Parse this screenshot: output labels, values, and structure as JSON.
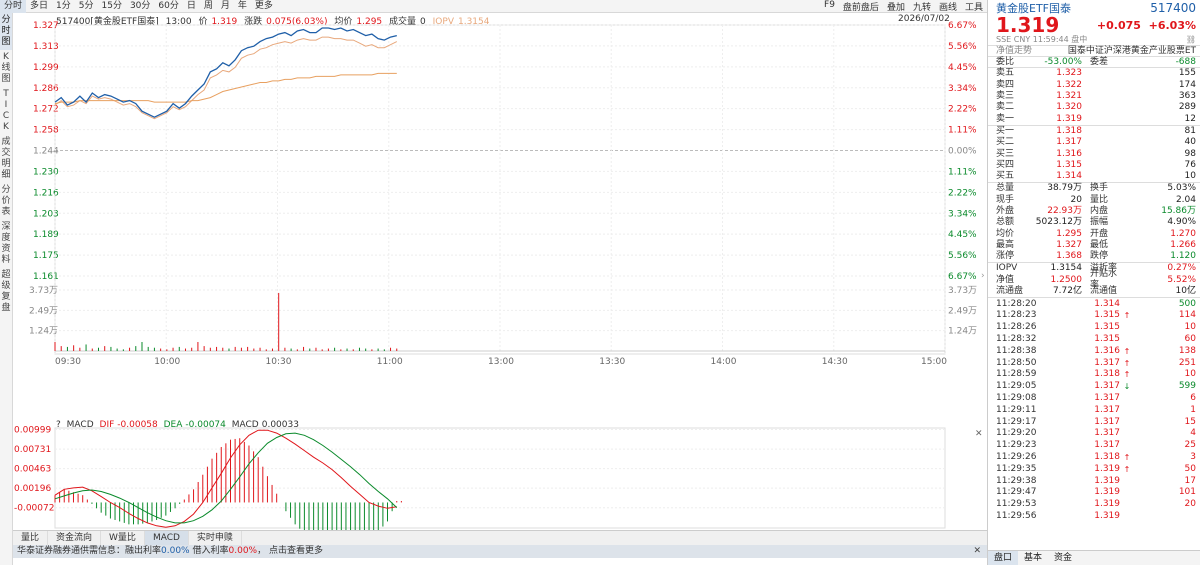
{
  "toolbar": {
    "tabs": [
      "分时",
      "多日",
      "1分",
      "5分",
      "15分",
      "30分",
      "60分",
      "日",
      "周",
      "月",
      "年",
      "更多"
    ],
    "right": [
      "F9",
      "盘前盘后",
      "叠加",
      "九转",
      "画线",
      "工具"
    ]
  },
  "left_tabs": [
    "分时图",
    "K线图",
    "TICK",
    "成交明细",
    "分价表",
    "深度资料",
    "超级复盘"
  ],
  "info": {
    "title": "517400[黄金股ETF国泰]",
    "time": "13:00",
    "price_label": "价",
    "price": "1.319",
    "chg_label": "涨跌",
    "chg": "0.075(6.03%)",
    "avg_label": "均价",
    "avg": "1.295",
    "vol_label": "成交量",
    "vol": "0",
    "iopv_label": "IOPV",
    "iopv": "1.3154",
    "date": "2026/07/02"
  },
  "chart_data": {
    "type": "line",
    "x_range": [
      "09:30",
      "15:00"
    ],
    "x_ticks": [
      "09:30",
      "10:00",
      "10:30",
      "11:00",
      "13:00",
      "13:30",
      "14:00",
      "14:30",
      "15:00"
    ],
    "price_ticks_up": [
      "1.327",
      "1.313",
      "1.299",
      "1.286",
      "1.272",
      "1.258"
    ],
    "price_mid": "1.244",
    "price_ticks_down": [
      "1.230",
      "1.216",
      "1.203",
      "1.189",
      "1.175",
      "1.161"
    ],
    "pct_ticks_up": [
      "6.67%",
      "5.56%",
      "4.45%",
      "3.34%",
      "2.22%",
      "1.11%"
    ],
    "pct_mid": "0.00%",
    "pct_ticks_down": [
      "1.11%",
      "2.22%",
      "3.34%",
      "4.45%",
      "5.56%",
      "6.67%"
    ],
    "vol_ticks": [
      "3.73万",
      "2.49万",
      "1.24万"
    ],
    "ylim": [
      1.161,
      1.327
    ],
    "price_series": [
      1.276,
      1.279,
      1.274,
      1.276,
      1.28,
      1.276,
      1.282,
      1.279,
      1.281,
      1.28,
      1.278,
      1.276,
      1.277,
      1.275,
      1.27,
      1.268,
      1.266,
      1.268,
      1.27,
      1.275,
      1.272,
      1.275,
      1.28,
      1.284,
      1.288,
      1.296,
      1.298,
      1.302,
      1.3,
      1.304,
      1.31,
      1.312,
      1.313,
      1.316,
      1.318,
      1.319,
      1.321,
      1.322,
      1.32,
      1.323,
      1.324,
      1.322,
      1.322,
      1.325,
      1.325,
      1.324,
      1.325,
      1.323,
      1.324,
      1.322,
      1.32,
      1.321,
      1.318,
      1.317,
      1.319,
      1.32
    ],
    "iopv_series": [
      1.274,
      1.277,
      1.273,
      1.274,
      1.277,
      1.275,
      1.28,
      1.278,
      1.279,
      1.278,
      1.276,
      1.274,
      1.275,
      1.273,
      1.269,
      1.267,
      1.265,
      1.267,
      1.269,
      1.273,
      1.271,
      1.273,
      1.277,
      1.281,
      1.284,
      1.292,
      1.294,
      1.297,
      1.296,
      1.299,
      1.305,
      1.307,
      1.308,
      1.311,
      1.312,
      1.314,
      1.315,
      1.316,
      1.315,
      1.317,
      1.318,
      1.317,
      1.317,
      1.319,
      1.319,
      1.318,
      1.318,
      1.317,
      1.317,
      1.315,
      1.313,
      1.314,
      1.312,
      1.312,
      1.314,
      1.316
    ],
    "avg_series": [
      1.275,
      1.276,
      1.276,
      1.276,
      1.277,
      1.277,
      1.277,
      1.277,
      1.277,
      1.277,
      1.277,
      1.277,
      1.277,
      1.277,
      1.277,
      1.277,
      1.276,
      1.276,
      1.276,
      1.276,
      1.276,
      1.276,
      1.277,
      1.277,
      1.278,
      1.279,
      1.281,
      1.283,
      1.284,
      1.285,
      1.286,
      1.287,
      1.288,
      1.289,
      1.289,
      1.29,
      1.29,
      1.291,
      1.291,
      1.292,
      1.292,
      1.292,
      1.293,
      1.293,
      1.293,
      1.293,
      1.294,
      1.294,
      1.294,
      1.294,
      1.294,
      1.294,
      1.295,
      1.295,
      1.295,
      1.295
    ],
    "volume_series": [
      0.55,
      0.3,
      0.25,
      0.35,
      0.2,
      0.4,
      0.15,
      0.2,
      0.3,
      0.25,
      0.15,
      0.1,
      0.2,
      0.3,
      0.55,
      0.25,
      0.2,
      0.15,
      0.1,
      0.2,
      0.25,
      0.15,
      0.2,
      0.55,
      0.3,
      0.2,
      0.25,
      0.2,
      0.15,
      0.25,
      0.2,
      0.25,
      0.15,
      0.2,
      0.1,
      0.15,
      3.55,
      0.2,
      0.15,
      0.1,
      0.25,
      0.15,
      0.2,
      0.1,
      0.15,
      0.2,
      0.1,
      0.15,
      0.1,
      0.2,
      0.15,
      0.1,
      0.15,
      0.1,
      0.2,
      0.15
    ],
    "vol_max": 3.73
  },
  "macd": {
    "label": "MACD",
    "dif_label": "DIF",
    "dif": "-0.00058",
    "dea_label": "DEA",
    "dea": "-0.00074",
    "macd_label": "MACD",
    "macd": "0.00033",
    "ticks": [
      "0.00999",
      "0.00731",
      "0.00463",
      "0.00196",
      "-0.00072"
    ],
    "dif_series": [
      0.001,
      0.0018,
      0.002,
      0.0021,
      0.0016,
      0.0008,
      0.0,
      -0.0007,
      -0.0015,
      -0.0022,
      -0.0028,
      -0.0032,
      -0.0034,
      -0.0032,
      -0.0026,
      -0.0016,
      0.0,
      0.002,
      0.004,
      0.0061,
      0.0079,
      0.0092,
      0.0099,
      0.0099,
      0.0095,
      0.0088,
      0.008,
      0.0071,
      0.0062,
      0.0054,
      0.0045,
      0.0034,
      0.0022,
      0.0011,
      0.0,
      -0.0005,
      -0.0008,
      -0.0006
    ],
    "dea_series": [
      0.0005,
      0.0009,
      0.0013,
      0.0016,
      0.0017,
      0.0015,
      0.0011,
      0.0006,
      0.0,
      -0.0007,
      -0.0014,
      -0.002,
      -0.0025,
      -0.0028,
      -0.0028,
      -0.0025,
      -0.0019,
      -0.001,
      0.0002,
      0.0018,
      0.0035,
      0.0053,
      0.0068,
      0.0081,
      0.0089,
      0.0094,
      0.0095,
      0.0092,
      0.0086,
      0.0078,
      0.0069,
      0.0059,
      0.0049,
      0.0038,
      0.0026,
      0.0015,
      0.0005,
      -0.0007
    ],
    "ylim": [
      -0.0035,
      0.0102
    ]
  },
  "bottom_tabs": [
    "量比",
    "资金流向",
    "W量比",
    "MACD",
    "实时申赎"
  ],
  "notice": {
    "prefix": "华泰证券融券通供需信息：融出利率",
    "rate1": "0.00%",
    "mid": "借入利率",
    "rate2": "0.00%",
    "suffix": "点击查看更多"
  },
  "right": {
    "name": "黄金股ETF国泰",
    "code": "517400",
    "price": "1.319",
    "chg": "+0.075",
    "pct": "+6.03%",
    "meta": [
      "SSE",
      "CNY",
      "11:59:44",
      "盘中"
    ],
    "meta_icon": "link-icon",
    "ref_label": "净值走势",
    "ref_value": "国泰中证沪深港黄金产业股票ET",
    "weibi_label": "委比",
    "weibi": "-53.00%",
    "weicha_label": "委差",
    "weicha": "-688",
    "asks": [
      {
        "l": "卖五",
        "p": "1.323",
        "v": "155"
      },
      {
        "l": "卖四",
        "p": "1.322",
        "v": "174"
      },
      {
        "l": "卖三",
        "p": "1.321",
        "v": "363"
      },
      {
        "l": "卖二",
        "p": "1.320",
        "v": "289"
      },
      {
        "l": "卖一",
        "p": "1.319",
        "v": "12"
      }
    ],
    "bids": [
      {
        "l": "买一",
        "p": "1.318",
        "v": "81"
      },
      {
        "l": "买二",
        "p": "1.317",
        "v": "40"
      },
      {
        "l": "买三",
        "p": "1.316",
        "v": "98"
      },
      {
        "l": "买四",
        "p": "1.315",
        "v": "76"
      },
      {
        "l": "买五",
        "p": "1.314",
        "v": "10"
      }
    ],
    "stats": [
      {
        "l1": "总量",
        "v1": "38.79万",
        "c1": "",
        "l2": "换手",
        "v2": "5.03%",
        "c2": ""
      },
      {
        "l1": "现手",
        "v1": "20",
        "c1": "",
        "l2": "量比",
        "v2": "2.04",
        "c2": ""
      },
      {
        "l1": "外盘",
        "v1": "22.93万",
        "c1": "red",
        "l2": "内盘",
        "v2": "15.86万",
        "c2": "green"
      },
      {
        "l1": "总额",
        "v1": "5023.12万",
        "c1": "",
        "l2": "振幅",
        "v2": "4.90%",
        "c2": ""
      },
      {
        "l1": "均价",
        "v1": "1.295",
        "c1": "red",
        "l2": "开盘",
        "v2": "1.270",
        "c2": "red"
      },
      {
        "l1": "最高",
        "v1": "1.327",
        "c1": "red",
        "l2": "最低",
        "v2": "1.266",
        "c2": "red"
      },
      {
        "l1": "涨停",
        "v1": "1.368",
        "c1": "red",
        "l2": "跌停",
        "v2": "1.120",
        "c2": "green"
      }
    ],
    "stats2": [
      {
        "l1": "IOPV",
        "v1": "1.3154",
        "c1": "",
        "l2": "溢折率",
        "v2": "0.27%",
        "c2": "red"
      },
      {
        "l1": "净值",
        "v1": "1.2500",
        "c1": "red",
        "l2": "开贴水率",
        "v2": "5.52%",
        "c2": "red"
      },
      {
        "l1": "流通盘",
        "v1": "7.72亿",
        "c1": "",
        "l2": "流通值",
        "v2": "10亿",
        "c2": ""
      }
    ],
    "trades": [
      {
        "t": "11:28:20",
        "p": "1.314",
        "a": "",
        "v": "500",
        "vc": "green"
      },
      {
        "t": "11:28:23",
        "p": "1.315",
        "a": "↑",
        "v": "114",
        "vc": "red"
      },
      {
        "t": "11:28:26",
        "p": "1.315",
        "a": "",
        "v": "10",
        "vc": "red"
      },
      {
        "t": "11:28:32",
        "p": "1.315",
        "a": "",
        "v": "60",
        "vc": "red"
      },
      {
        "t": "11:28:38",
        "p": "1.316",
        "a": "↑",
        "v": "138",
        "vc": "red"
      },
      {
        "t": "11:28:50",
        "p": "1.317",
        "a": "↑",
        "v": "251",
        "vc": "red"
      },
      {
        "t": "11:28:59",
        "p": "1.318",
        "a": "↑",
        "v": "10",
        "vc": "red"
      },
      {
        "t": "11:29:05",
        "p": "1.317",
        "a": "↓",
        "v": "599",
        "vc": "green"
      },
      {
        "t": "11:29:08",
        "p": "1.317",
        "a": "",
        "v": "6",
        "vc": "red"
      },
      {
        "t": "11:29:11",
        "p": "1.317",
        "a": "",
        "v": "1",
        "vc": "red"
      },
      {
        "t": "11:29:17",
        "p": "1.317",
        "a": "",
        "v": "15",
        "vc": "red"
      },
      {
        "t": "11:29:20",
        "p": "1.317",
        "a": "",
        "v": "4",
        "vc": "red"
      },
      {
        "t": "11:29:23",
        "p": "1.317",
        "a": "",
        "v": "25",
        "vc": "red"
      },
      {
        "t": "11:29:26",
        "p": "1.318",
        "a": "↑",
        "v": "3",
        "vc": "red"
      },
      {
        "t": "11:29:35",
        "p": "1.319",
        "a": "↑",
        "v": "50",
        "vc": "red"
      },
      {
        "t": "11:29:38",
        "p": "1.319",
        "a": "",
        "v": "17",
        "vc": "red"
      },
      {
        "t": "11:29:47",
        "p": "1.319",
        "a": "",
        "v": "101",
        "vc": "red"
      },
      {
        "t": "11:29:53",
        "p": "1.319",
        "a": "",
        "v": "20",
        "vc": "red"
      },
      {
        "t": "11:29:56",
        "p": "1.319",
        "a": "",
        "v": "",
        "vc": "red"
      }
    ],
    "tabs": [
      "盘口",
      "基本",
      "资金"
    ]
  },
  "colors": {
    "up": "#e0161b",
    "down": "#0a8a2b",
    "price_line": "#1f5fa8",
    "iopv_line": "#e8a87c",
    "avg_line": "#e8a060"
  }
}
